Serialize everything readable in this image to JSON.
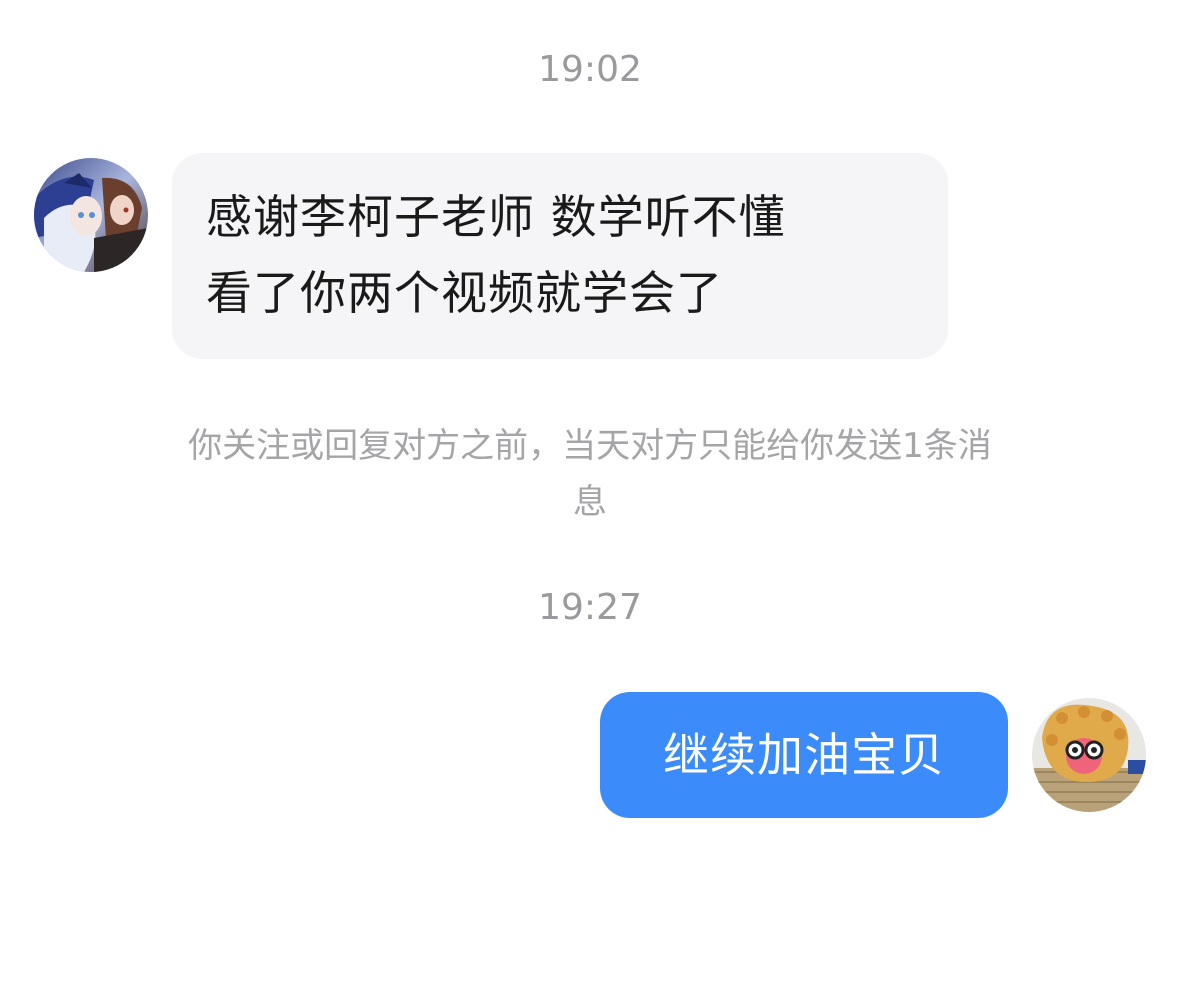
{
  "messages": [
    {
      "timestamp": "19:02",
      "direction": "incoming",
      "lines": [
        "感谢李柯子老师 数学听不懂",
        "看了你两个视频就学会了"
      ]
    },
    {
      "timestamp": "19:27",
      "direction": "outgoing",
      "text": "继续加油宝贝"
    }
  ],
  "notice": {
    "lines": [
      "你关注或回复对方之前，当天对方只能给你发送1条消",
      "息"
    ]
  },
  "colors": {
    "incoming_bubble": "#f5f5f7",
    "outgoing_bubble": "#3b8bfa",
    "timestamp_text": "#9a9a9e",
    "notice_text": "#a5a5a8"
  },
  "icons": {
    "sender_avatar": "anime-characters-avatar-icon",
    "self_avatar": "plush-toy-sunglasses-avatar-icon"
  }
}
